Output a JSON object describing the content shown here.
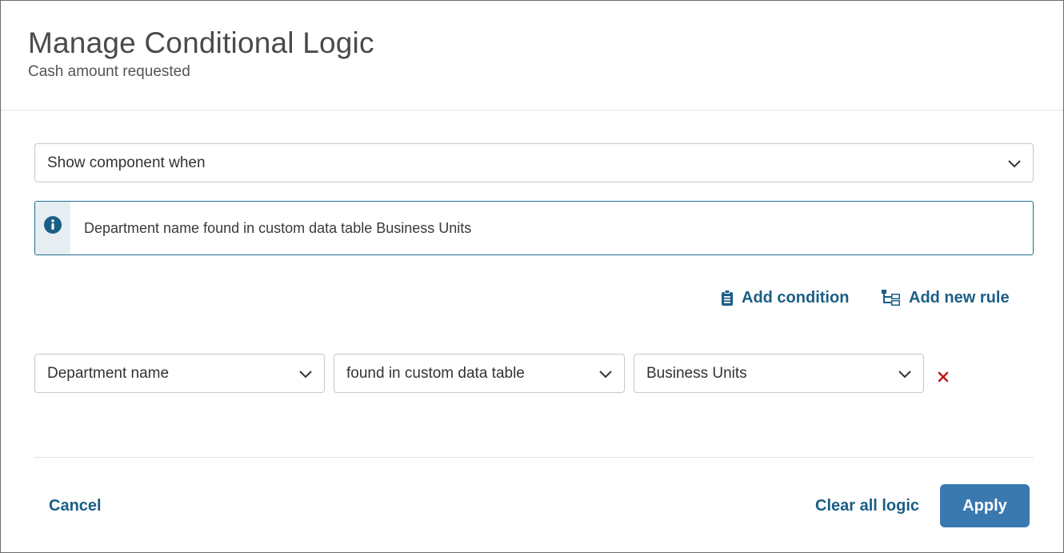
{
  "dialog": {
    "title": "Manage Conditional Logic",
    "subtitle": "Cash amount requested"
  },
  "mode_select": {
    "value": "Show component when"
  },
  "info_banner": {
    "icon": "info-icon",
    "text": "Department name found in custom data table Business Units"
  },
  "actions": {
    "add_condition": {
      "label": "Add condition",
      "icon": "clipboard-icon"
    },
    "add_rule": {
      "label": "Add new rule",
      "icon": "hierarchy-icon"
    }
  },
  "condition": {
    "field": "Department name",
    "operator": "found in custom data table",
    "value": "Business Units",
    "remove_icon": "close-icon"
  },
  "footer": {
    "cancel_label": "Cancel",
    "clear_label": "Clear all logic",
    "apply_label": "Apply"
  },
  "colors": {
    "accent": "#1b5e85",
    "apply_bg": "#3a78b0",
    "remove": "#c0171c",
    "info_stripe": "#e6eef2"
  }
}
